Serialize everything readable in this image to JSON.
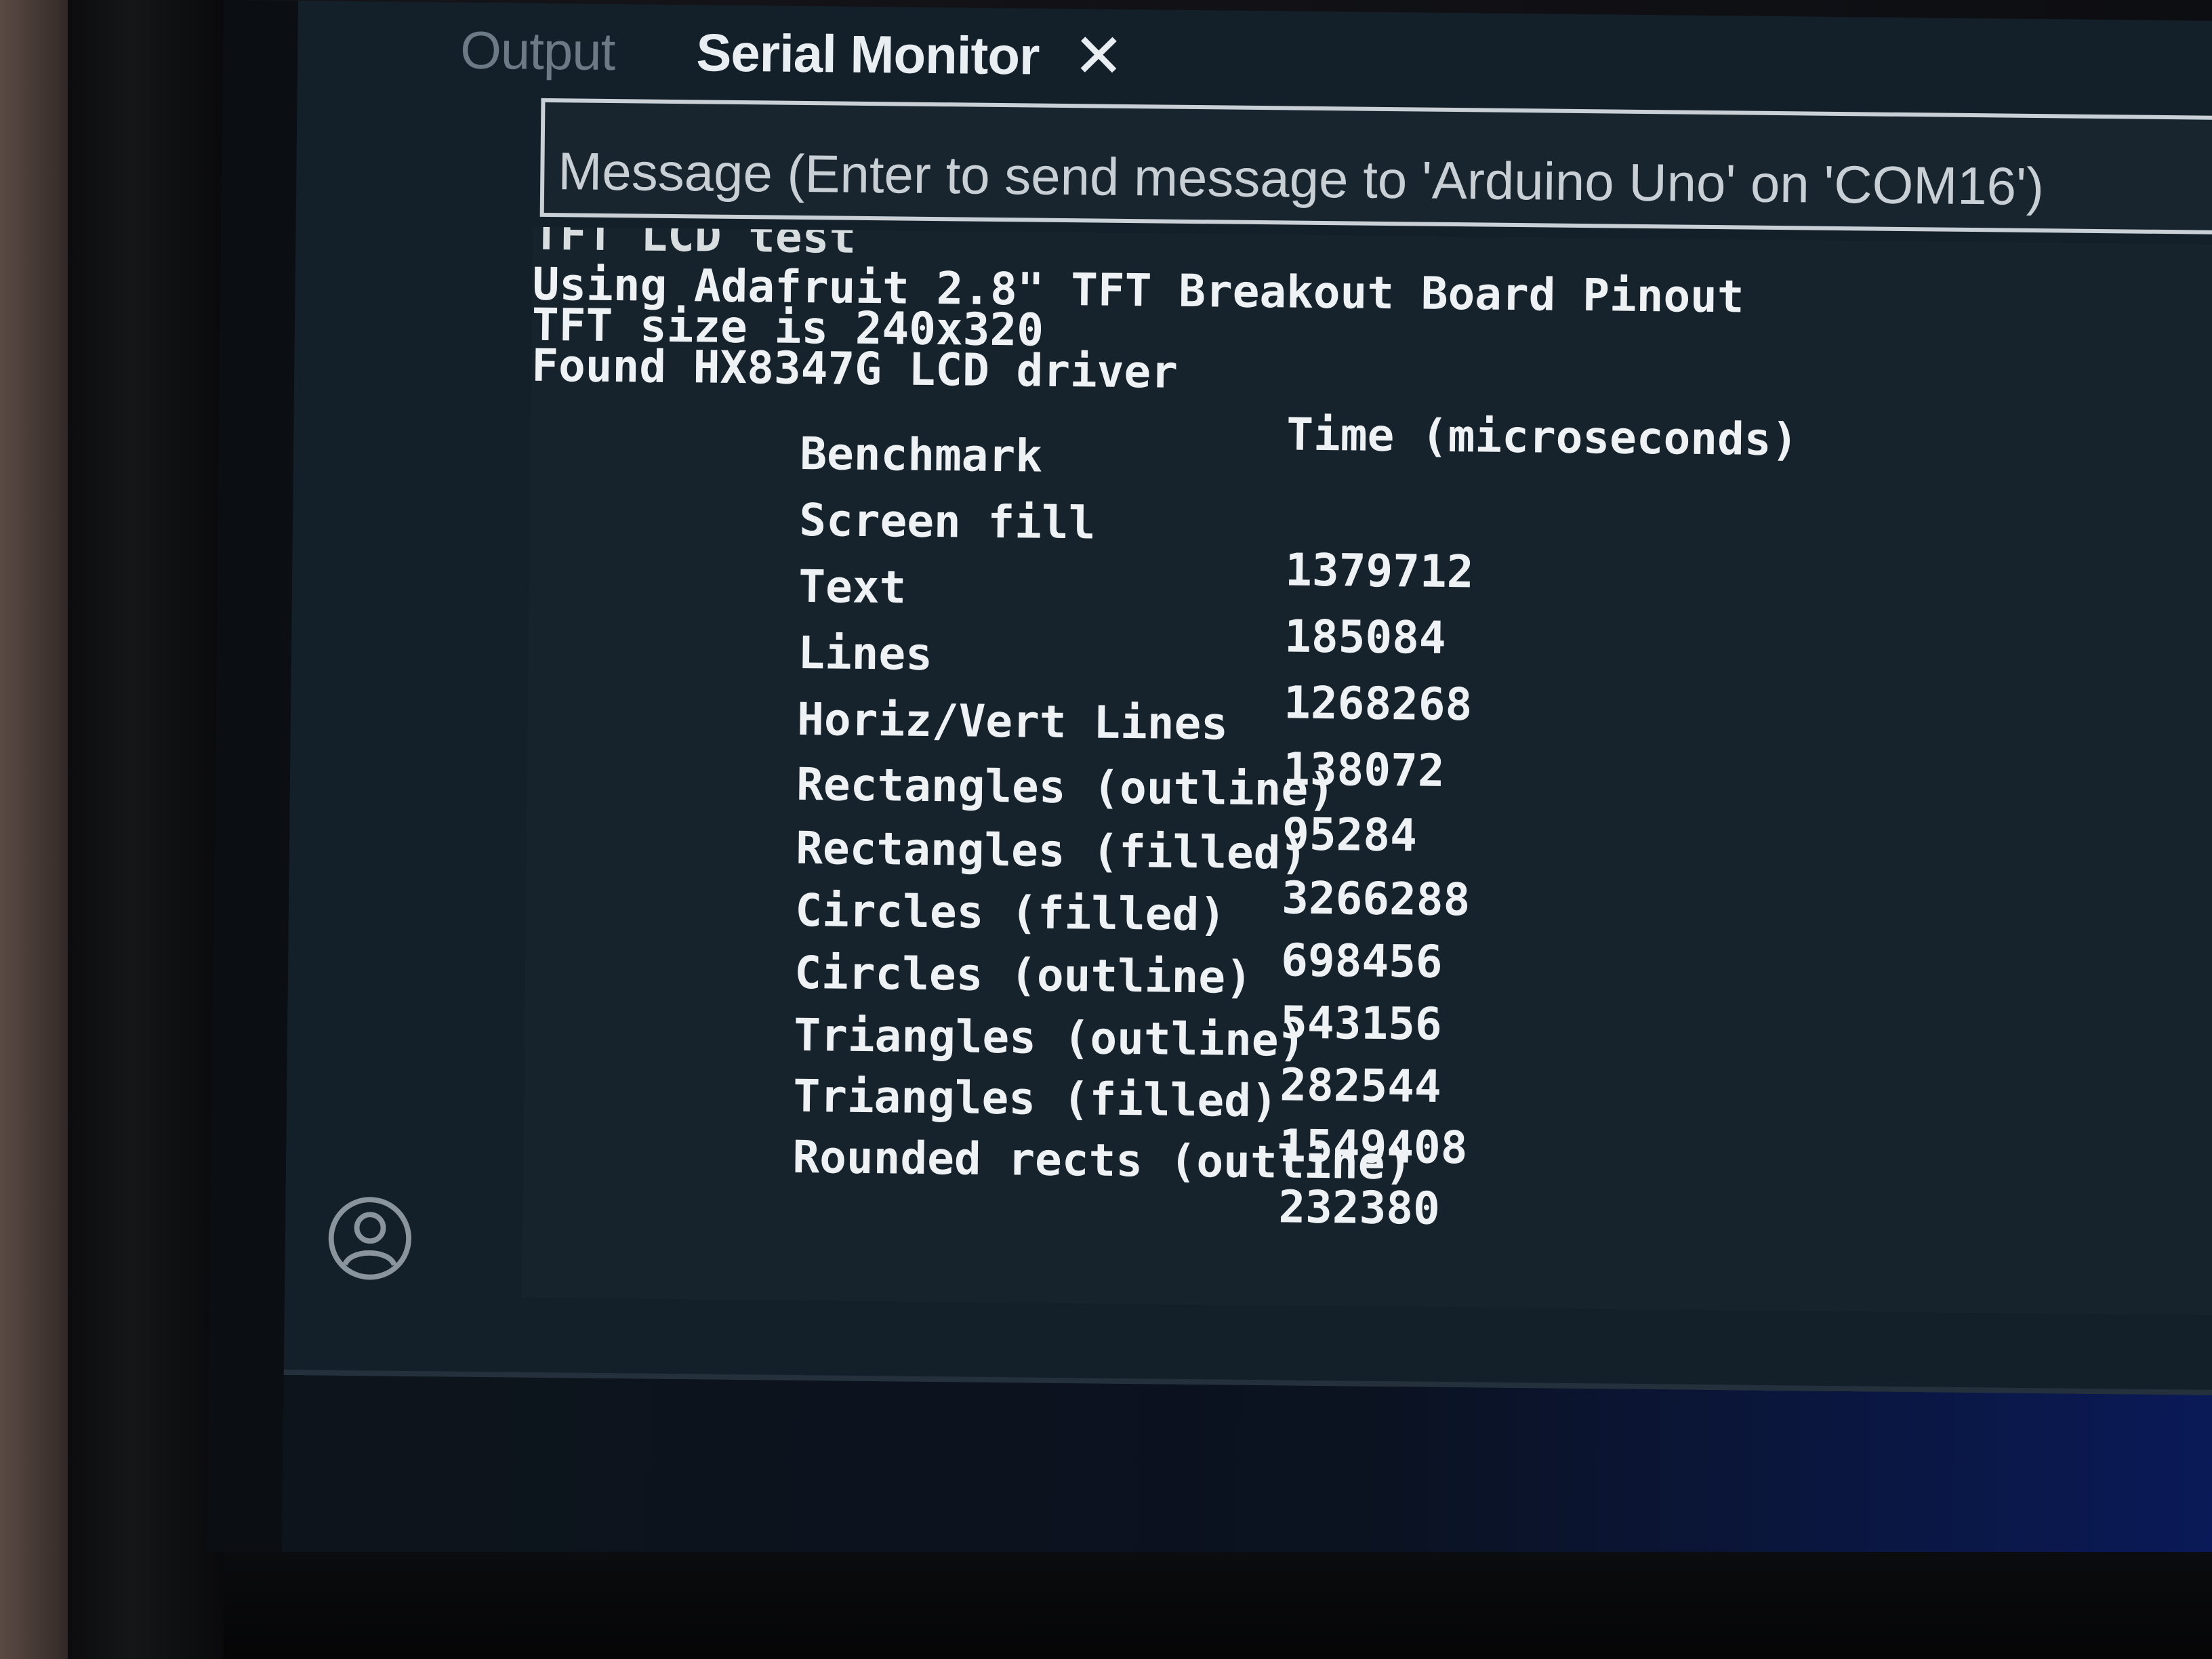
{
  "tabs": [
    {
      "label": "Output",
      "active": false
    },
    {
      "label": "Serial Monitor",
      "active": true
    }
  ],
  "close_icon": "close-icon",
  "message_input": {
    "placeholder": "Message (Enter to send message to 'Arduino Uno' on 'COM16')",
    "value": ""
  },
  "serial_output": {
    "clipped_top_line": "TFT LCD test",
    "lines": [
      "Using Adafruit 2.8\" TFT Breakout Board Pinout",
      "TFT size is 240x320",
      "Found HX8347G LCD driver"
    ],
    "benchmark_header": {
      "label": "Benchmark",
      "time": "Time (microseconds)"
    },
    "benchmark_rows": [
      {
        "name": "Screen fill",
        "time": "1379712"
      },
      {
        "name": "Text",
        "time": "185084"
      },
      {
        "name": "Lines",
        "time": "1268268"
      },
      {
        "name": "Horiz/Vert Lines",
        "time": "138072"
      },
      {
        "name": "Rectangles (outline)",
        "time": "95284"
      },
      {
        "name": "Rectangles (filled)",
        "time": "3266288"
      },
      {
        "name": "Circles (filled)",
        "time": "698456"
      },
      {
        "name": "Circles (outline)",
        "time": "543156"
      },
      {
        "name": "Triangles (outline)",
        "time": "282544"
      },
      {
        "name": "Triangles (filled)",
        "time": "1549408"
      }
    ],
    "clipped_bottom_row": {
      "name": "Rounded rects (outline)",
      "time": "232380"
    }
  },
  "account_icon": "account-icon",
  "colors": {
    "panel_background": "#142029",
    "output_text": "#eef2f4",
    "inactive_tab": "#6c7a86",
    "status_accent": "#0a1a5a"
  }
}
